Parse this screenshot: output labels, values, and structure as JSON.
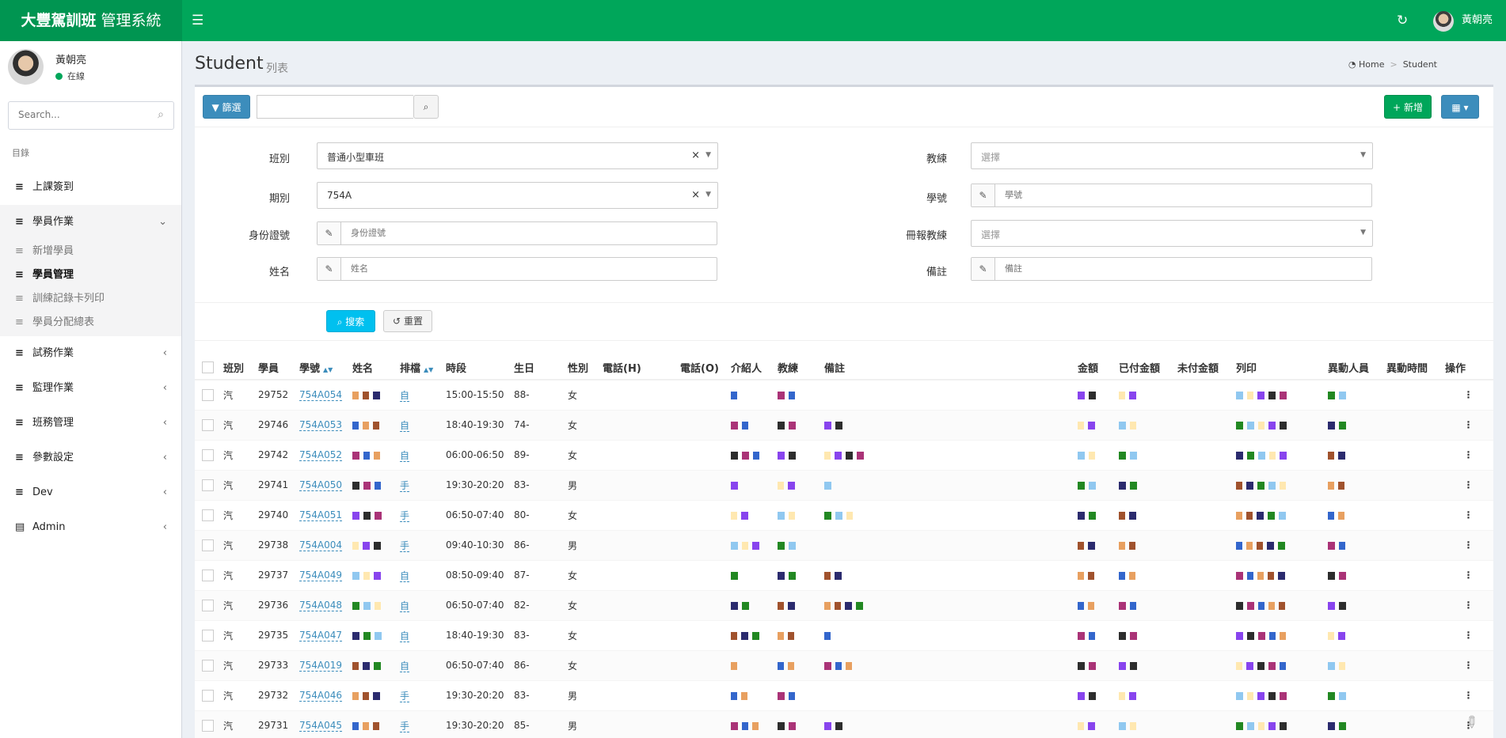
{
  "app": {
    "brand_bold": "大豐駕訓班",
    "brand_rest": "管理系統",
    "menu_icon": "hamburger-icon",
    "refresh_icon": "refresh-icon",
    "user": "黃朝亮"
  },
  "sidebar": {
    "user_name": "黃朝亮",
    "status": "在線",
    "search_placeholder": "Search...",
    "section": "目錄",
    "items": [
      {
        "label": "上課簽到",
        "arrow": ""
      },
      {
        "label": "學員作業",
        "arrow": "⌄"
      },
      {
        "label": "試務作業",
        "arrow": "‹"
      },
      {
        "label": "監理作業",
        "arrow": "‹"
      },
      {
        "label": "班務管理",
        "arrow": "‹"
      },
      {
        "label": "參數設定",
        "arrow": "‹"
      },
      {
        "label": "Dev",
        "arrow": "‹"
      },
      {
        "label": "Admin",
        "arrow": "‹"
      }
    ],
    "subitems": [
      {
        "label": "新增學員"
      },
      {
        "label": "學員管理"
      },
      {
        "label": "訓練記錄卡列印"
      },
      {
        "label": "學員分配總表"
      }
    ]
  },
  "page": {
    "title": "Student",
    "subtitle": "列表",
    "crumb_home": "Home",
    "crumb_current": "Student"
  },
  "toolbar": {
    "filter": "篩選",
    "add": "新增",
    "columns_icon": "table-columns-icon"
  },
  "filters": {
    "class_label": "班別",
    "class_value": "普通小型車班",
    "term_label": "期別",
    "term_value": "754A",
    "id_label": "身份證號",
    "id_placeholder": "身份證號",
    "name_label": "姓名",
    "name_placeholder": "姓名",
    "coach_label": "教練",
    "coach_placeholder": "選擇",
    "stuno_label": "學號",
    "stuno_placeholder": "學號",
    "reg_coach_label": "冊報教練",
    "reg_coach_placeholder": "選擇",
    "note_label": "備註",
    "note_placeholder": "備註",
    "search": "搜索",
    "reset": "重置"
  },
  "table": {
    "headers": [
      "班別",
      "學員",
      "學號",
      "姓名",
      "排檔",
      "時段",
      "生日",
      "性別",
      "電話(H)",
      "電話(O)",
      "介紹人",
      "教練",
      "備註",
      "金額",
      "已付金額",
      "未付金額",
      "列印",
      "異動人員",
      "異動時間",
      "操作"
    ],
    "rows": [
      {
        "cls": "汽",
        "id": "29752",
        "no": "754A054",
        "gear": "自",
        "time": "15:00-15:50",
        "bday": "88-",
        "sex": "女"
      },
      {
        "cls": "汽",
        "id": "29746",
        "no": "754A053",
        "gear": "自",
        "time": "18:40-19:30",
        "bday": "74-",
        "sex": "女"
      },
      {
        "cls": "汽",
        "id": "29742",
        "no": "754A052",
        "gear": "自",
        "time": "06:00-06:50",
        "bday": "89-",
        "sex": "女"
      },
      {
        "cls": "汽",
        "id": "29741",
        "no": "754A050",
        "gear": "手",
        "time": "19:30-20:20",
        "bday": "83-",
        "sex": "男"
      },
      {
        "cls": "汽",
        "id": "29740",
        "no": "754A051",
        "gear": "手",
        "time": "06:50-07:40",
        "bday": "80-",
        "sex": "女"
      },
      {
        "cls": "汽",
        "id": "29738",
        "no": "754A004",
        "gear": "手",
        "time": "09:40-10:30",
        "bday": "86-",
        "sex": "男"
      },
      {
        "cls": "汽",
        "id": "29737",
        "no": "754A049",
        "gear": "自",
        "time": "08:50-09:40",
        "bday": "87-",
        "sex": "女"
      },
      {
        "cls": "汽",
        "id": "29736",
        "no": "754A048",
        "gear": "自",
        "time": "06:50-07:40",
        "bday": "82-",
        "sex": "女"
      },
      {
        "cls": "汽",
        "id": "29735",
        "no": "754A047",
        "gear": "自",
        "time": "18:40-19:30",
        "bday": "83-",
        "sex": "女"
      },
      {
        "cls": "汽",
        "id": "29733",
        "no": "754A019",
        "gear": "自",
        "time": "06:50-07:40",
        "bday": "86-",
        "sex": "女"
      },
      {
        "cls": "汽",
        "id": "29732",
        "no": "754A046",
        "gear": "手",
        "time": "19:30-20:20",
        "bday": "83-",
        "sex": "男"
      },
      {
        "cls": "汽",
        "id": "29731",
        "no": "754A045",
        "gear": "手",
        "time": "19:30-20:20",
        "bday": "85-",
        "sex": "男"
      }
    ]
  },
  "colors": {
    "header": "#00a65a",
    "primary": "#3c8dbc",
    "info": "#00c0ef",
    "success": "#00a65a"
  }
}
